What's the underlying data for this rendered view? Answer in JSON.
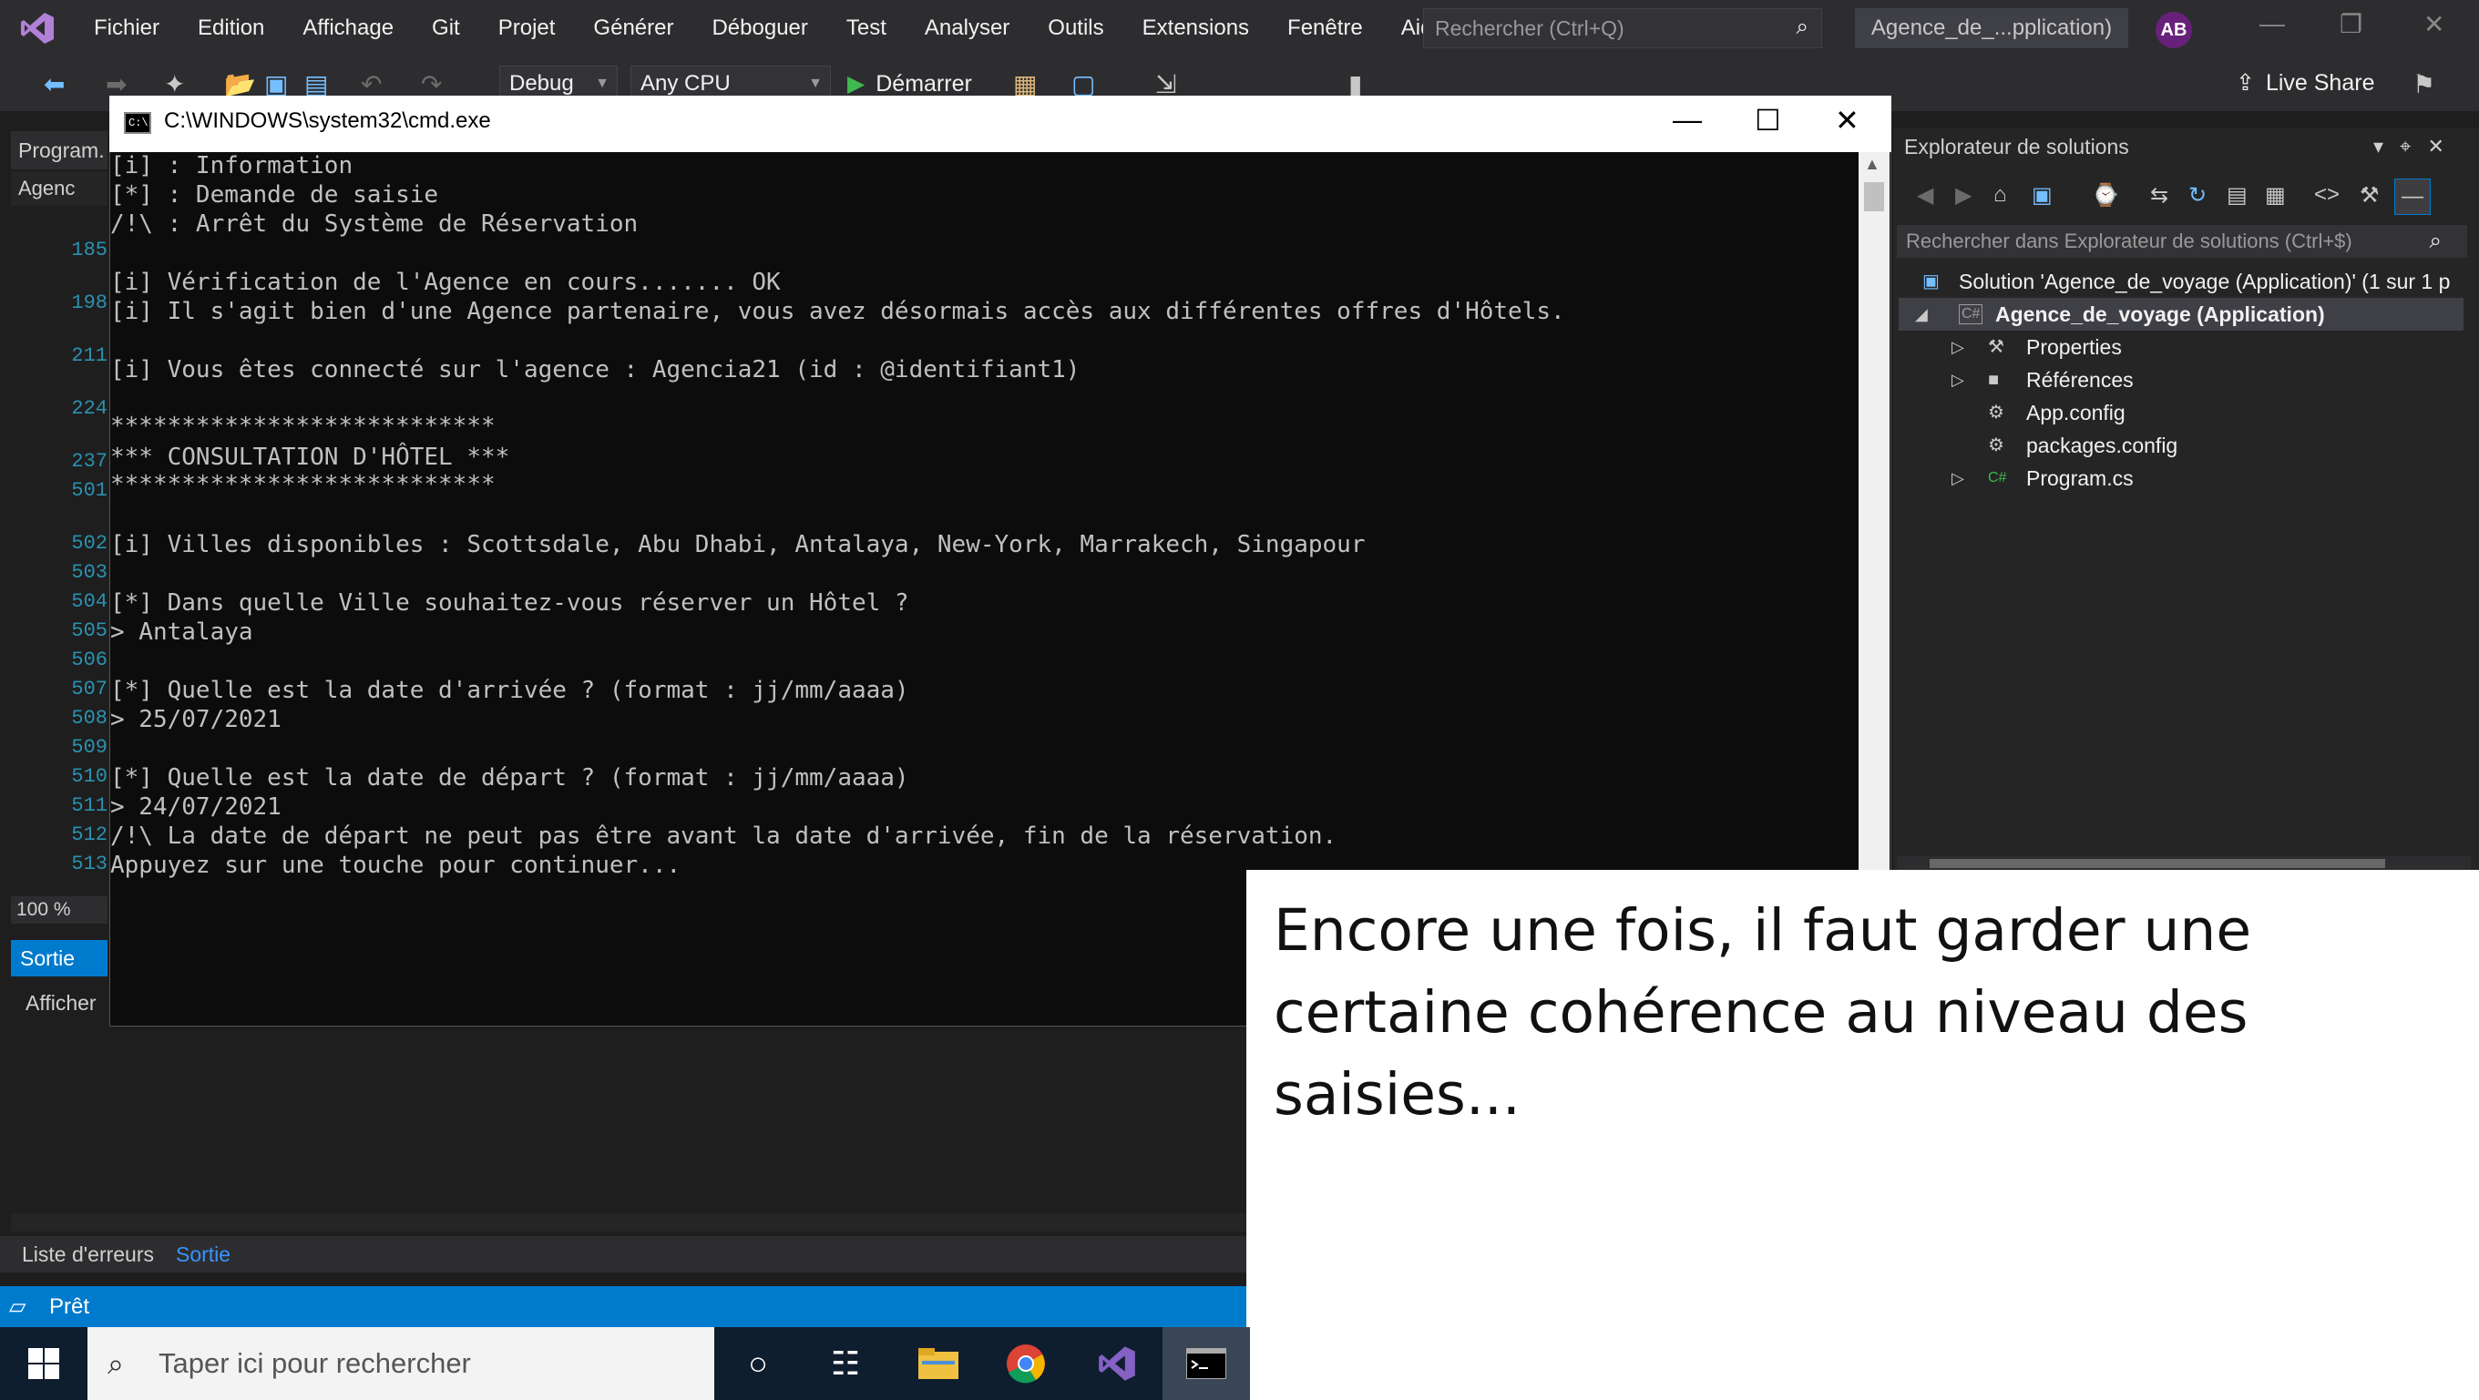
{
  "menubar": {
    "items": [
      "Fichier",
      "Edition",
      "Affichage",
      "Git",
      "Projet",
      "Générer",
      "Déboguer",
      "Test",
      "Analyser",
      "Outils",
      "Extensions",
      "Fenêtre",
      "Aide"
    ],
    "search_placeholder": "Rechercher (Ctrl+Q)",
    "project_title": "Agence_de_...pplication)",
    "avatar_initials": "AB"
  },
  "toolbar": {
    "config": "Debug",
    "platform": "Any CPU",
    "start_label": "Démarrer",
    "live_share": "Live Share"
  },
  "editor": {
    "tab_label": "Program.",
    "nav_label": "Agenc",
    "line_numbers": [
      "185",
      "198",
      "211",
      "224",
      "237",
      "501",
      "502",
      "503",
      "504",
      "505",
      "506",
      "507",
      "508",
      "509",
      "510",
      "511",
      "512",
      "513"
    ],
    "zoom": "100 %"
  },
  "output": {
    "title": "Sortie",
    "show_label": "Afficher"
  },
  "bottom_tabs": {
    "errors": "Liste d'erreurs",
    "output": "Sortie"
  },
  "status": {
    "text": "Prêt"
  },
  "solution_explorer": {
    "title": "Explorateur de solutions",
    "search_placeholder": "Rechercher dans Explorateur de solutions (Ctrl+$)",
    "solution": "Solution 'Agence_de_voyage (Application)' (1 sur 1 p",
    "project": "Agence_de_voyage (Application)",
    "items": [
      "Properties",
      "Références",
      "App.config",
      "packages.config",
      "Program.cs"
    ]
  },
  "cmd": {
    "title": "C:\\WINDOWS\\system32\\cmd.exe",
    "lines": [
      "[i] : Information",
      "[*] : Demande de saisie",
      "/!\\ : Arrêt du Système de Réservation",
      "",
      "[i] Vérification de l'Agence en cours....... OK",
      "[i] Il s'agit bien d'une Agence partenaire, vous avez désormais accès aux différentes offres d'Hôtels.",
      "",
      "[i] Vous êtes connecté sur l'agence : Agencia21 (id : @identifiant1)",
      "",
      "***************************",
      "*** CONSULTATION D'HÔTEL ***",
      "***************************",
      "",
      "[i] Villes disponibles : Scottsdale, Abu Dhabi, Antalaya, New-York, Marrakech, Singapour",
      "",
      "[*] Dans quelle Ville souhaitez-vous réserver un Hôtel ?",
      "> Antalaya",
      "",
      "[*] Quelle est la date d'arrivée ? (format : jj/mm/aaaa)",
      "> 25/07/2021",
      "",
      "[*] Quelle est la date de départ ? (format : jj/mm/aaaa)",
      "> 24/07/2021",
      "/!\\ La date de départ ne peut pas être avant la date d'arrivée, fin de la réservation.",
      "Appuyez sur une touche pour continuer..."
    ]
  },
  "caption": {
    "text": "Encore une fois, il faut garder une certaine cohérence au niveau des saisies..."
  },
  "taskbar": {
    "search_placeholder": "Taper ici pour rechercher"
  },
  "colors": {
    "accent": "#007acc",
    "vs_purple": "#68217a",
    "cmd_bg": "#0c0c0c",
    "cmd_text": "#c0c0c0"
  }
}
